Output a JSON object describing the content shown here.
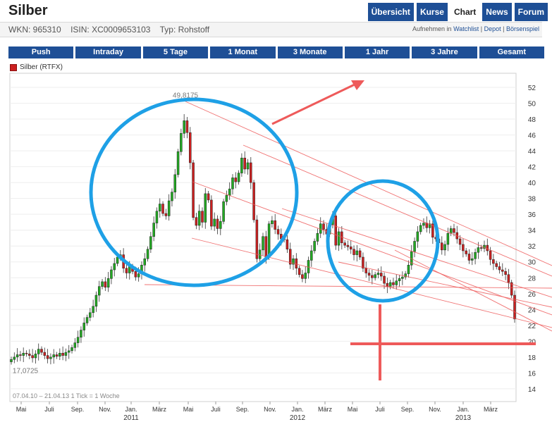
{
  "header": {
    "title": "Silber",
    "tabs": [
      {
        "label": "Übersicht",
        "active": false
      },
      {
        "label": "Kurse",
        "active": false
      },
      {
        "label": "Chart",
        "active": true
      },
      {
        "label": "News",
        "active": false
      },
      {
        "label": "Forum",
        "active": false
      }
    ]
  },
  "info": {
    "wkn": "WKN: 965310",
    "isin": "ISIN: XC0009653103",
    "typ": "Typ: Rohstoff",
    "aufnehmen": "Aufnehmen in",
    "watchlist": "Watchlist",
    "depot": "Depot",
    "boersenspiel": "Börsenspiel"
  },
  "ranges": [
    "Push",
    "Intraday",
    "5 Tage",
    "1 Monat",
    "3 Monate",
    "1 Jahr",
    "3 Jahre",
    "Gesamt"
  ],
  "legend": {
    "label": "Silber (RTFX)"
  },
  "colors": {
    "up": "#22aa22",
    "down": "#cc2020",
    "accent": "#1e4f96",
    "circle": "#1ea0e6",
    "annotation": "#ee5a5a"
  },
  "chart_data": {
    "type": "candlestick",
    "series": [
      {
        "name": "Silber (RTFX)"
      }
    ],
    "period": "07.04.10 – 21.04.13",
    "tick_info": "1 Tick = 1 Woche",
    "ylim": [
      12,
      53
    ],
    "yticks": [
      14,
      16,
      18,
      20,
      22,
      24,
      26,
      28,
      30,
      32,
      34,
      36,
      38,
      40,
      42,
      44,
      46,
      48,
      50,
      52
    ],
    "x_month_labels": [
      "Mai",
      "Juli",
      "Sep.",
      "Nov.",
      "Jan.",
      "März",
      "Mai",
      "Juli",
      "Sep.",
      "Nov.",
      "Jan.",
      "März",
      "Mai",
      "Juli",
      "Sep.",
      "Nov.",
      "Jan.",
      "März"
    ],
    "x_year_labels": [
      "2011",
      "2012",
      "2013"
    ],
    "annotations": {
      "high": "49,8175",
      "low": "17,0725"
    },
    "weekly_close": [
      17.7,
      18.0,
      18.3,
      18.2,
      18.5,
      18.4,
      18.2,
      17.9,
      18.4,
      19.0,
      18.6,
      18.2,
      17.8,
      18.0,
      18.3,
      18.1,
      18.5,
      18.2,
      18.6,
      18.8,
      19.2,
      19.8,
      20.5,
      21.4,
      22.3,
      23.0,
      23.6,
      24.4,
      25.8,
      26.9,
      27.5,
      26.8,
      27.9,
      29.0,
      29.8,
      30.6,
      30.9,
      29.2,
      28.6,
      29.4,
      28.8,
      28.1,
      28.5,
      29.6,
      30.4,
      31.6,
      33.2,
      34.9,
      36.4,
      37.3,
      36.1,
      35.8,
      37.7,
      38.8,
      41.0,
      43.9,
      46.2,
      47.8,
      46.3,
      42.5,
      35.6,
      34.6,
      36.4,
      35.0,
      38.6,
      37.8,
      34.5,
      35.4,
      34.2,
      35.1,
      37.6,
      38.4,
      39.2,
      40.6,
      40.1,
      41.2,
      43.1,
      41.7,
      42.5,
      40.0,
      35.3,
      30.4,
      31.5,
      33.2,
      30.6,
      34.8,
      35.2,
      34.1,
      33.5,
      32.9,
      32.8,
      31.6,
      29.7,
      30.4,
      29.2,
      28.4,
      27.9,
      28.6,
      30.2,
      31.4,
      32.6,
      33.6,
      34.8,
      34.1,
      33.5,
      34.7,
      35.8,
      32.1,
      33.8,
      32.4,
      32.1,
      31.9,
      31.6,
      30.9,
      31.4,
      30.6,
      29.2,
      28.6,
      28.3,
      28.0,
      28.4,
      28.6,
      28.2,
      27.3,
      26.9,
      27.4,
      27.1,
      27.6,
      27.9,
      28.1,
      28.5,
      29.6,
      31.3,
      32.6,
      33.8,
      34.6,
      34.9,
      34.3,
      34.8,
      33.1,
      32.9,
      32.4,
      31.5,
      32.2,
      33.6,
      34.2,
      33.7,
      32.9,
      32.2,
      31.4,
      31.0,
      30.2,
      30.4,
      31.2,
      31.8,
      31.7,
      32.1,
      31.4,
      30.3,
      29.8,
      29.4,
      29.0,
      28.8,
      28.4,
      27.4,
      25.8,
      22.8
    ]
  }
}
